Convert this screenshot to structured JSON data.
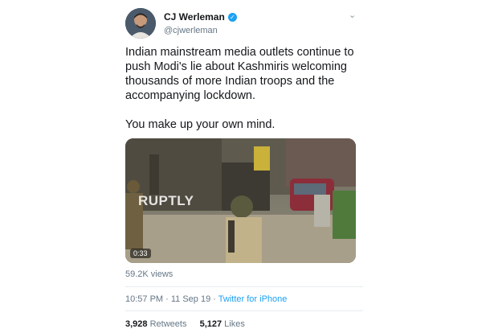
{
  "user": {
    "display_name": "CJ Werleman",
    "handle": "@cjwerleman",
    "avatar_icon": "avatar-photo",
    "verified_icon": "verified-badge-icon",
    "verified_color": "#1da1f2"
  },
  "tweet": {
    "paragraph_1": "Indian mainstream media outlets continue to push Modi's lie about Kashmiris welcoming thousands of more Indian troops and the accompanying lockdown.",
    "paragraph_2": "You make up your own mind."
  },
  "video": {
    "watermark": "RUPTLY",
    "duration": "0:33"
  },
  "views": "59.2K views",
  "meta": {
    "time": "10:57 PM",
    "separator": " · ",
    "date": "11 Sep 19",
    "source": "Twitter for iPhone",
    "source_color": "#1da1f2"
  },
  "stats": {
    "retweets_count": "3,928",
    "retweets_label": "Retweets",
    "likes_count": "5,127",
    "likes_label": "Likes"
  },
  "icons": {
    "menu": "chevron-down-icon"
  }
}
